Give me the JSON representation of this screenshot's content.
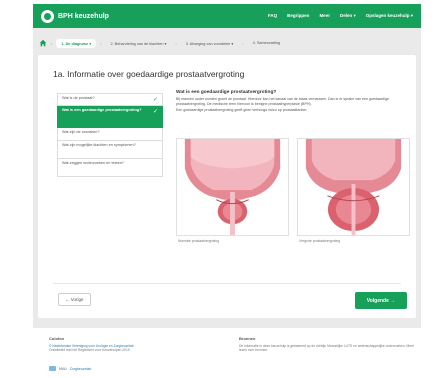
{
  "navbar": {
    "brand": "BPH keuzehulp",
    "links": [
      "FAQ",
      "Begrippen",
      "Meer",
      "Delen ▾",
      "Opslagen keuzehulp ▾"
    ]
  },
  "breadcrumb": {
    "items": [
      "1. De diagnose ▾",
      "2. Behandeling van de klachten ▾",
      "3. Afweging van voordelen ▾",
      "4. Samenvatting"
    ]
  },
  "card": {
    "title": "1a. Informatie over goedaardige prostaatvergroting",
    "steps": [
      {
        "label": "Wat is de prostaat?",
        "state": "done"
      },
      {
        "label": "Wat is een goedaardige prostaatvergroting?",
        "state": "active"
      },
      {
        "label": "Wat zijn de oorzaken?",
        "state": "normal"
      },
      {
        "label": "Wat zijn mogelijke klachten en symptomen?",
        "state": "normal"
      },
      {
        "label": "Wat zeggen onderzoeken en testen?",
        "state": "normal"
      }
    ],
    "article": {
      "heading": "Wat is een goedaardige prostaatvergroting?",
      "text": "Bij mannen ouder worden groeit de prostaat. Hierdoor kan het kanaal van de blaas vernauwen. Dan is er sprake van een goedaardige prostaatvergroting. De medische term hiervoor is benigne prostaathyperplasie (BPH).",
      "text2": "Een goedaardige prostaatvergroting geeft geen verhoogd risico op prostaatkanker."
    },
    "captions": {
      "left": "Normale prostaatvergroting",
      "right": "Vergrote prostaatvergroting"
    },
    "prev_label": "← Vorige",
    "next_label": "Volgende →"
  },
  "footer": {
    "left_heading": "Colofon",
    "left_link": "© Nederlandse Vereniging voor Urologie en Zorgkeuzelab",
    "left_text": "Ontwikkeld met het Reglement voor Keuzehulpen 2019",
    "right_heading": "Bronnen",
    "right_text": "De informatie in deze keuzehulp is gebaseerd op de richtlijn Mannelijke LUTS en wetenschappelijke onderzoeken. Meer lezen over bronnen.",
    "logo_text": "NVU",
    "logo_link": "Zorgkeuzelab"
  },
  "colors": {
    "brand_green": "#17a05a",
    "background_grey": "#eaeaea",
    "link_blue": "#2a7ab9"
  }
}
